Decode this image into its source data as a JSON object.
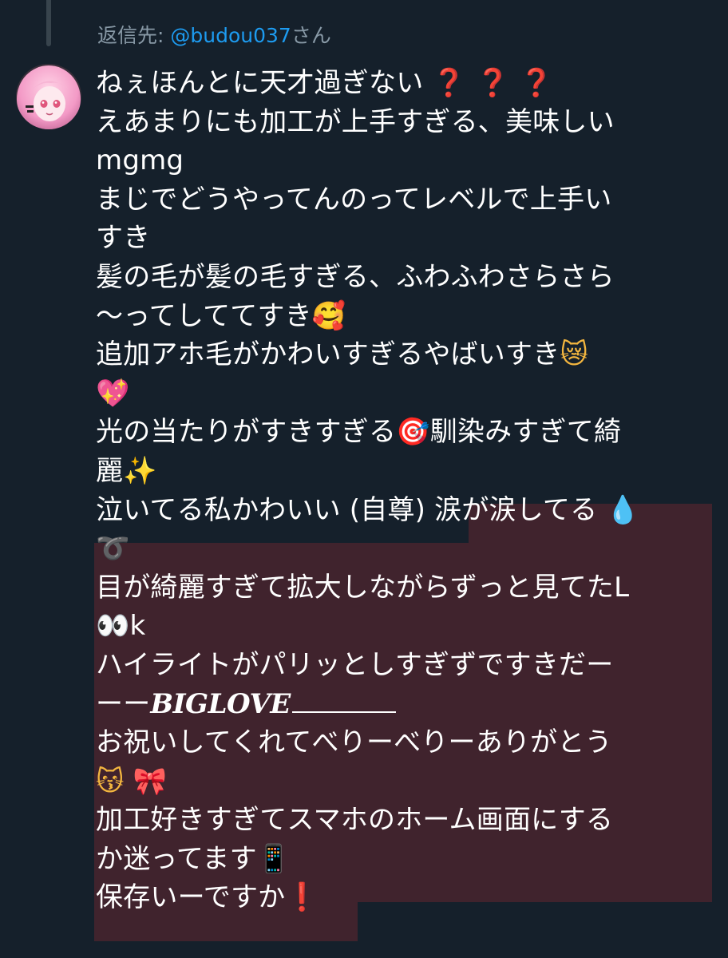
{
  "reply": {
    "prefix": "返信先:",
    "handle": "@budou037",
    "suffix": "さん"
  },
  "tweet": {
    "line1_text": "ねぇほんとに天才過ぎない",
    "line1_marks": "❓ ❓ ❓",
    "line2": "えあまりにも加工が上手すぎる、美味しい",
    "line3": " mgmg",
    "line4": "まじでどうやってんのってレベルで上手い",
    "line5": "すき",
    "line6": "髪の毛が髪の毛すぎる、ふわふわさらさら",
    "line7_text": "～ってしててすき",
    "line7_emoji": "🥰",
    "line8_text": "追加アホ毛がかわいすぎるやばいすき",
    "line8_emoji": "😿",
    "line9_emoji": "💖",
    "line10_text_a": "光の当たりがすきすぎる",
    "line10_emoji": "🎯",
    "line10_text_b": "馴染みすぎて綺",
    "line11_text": "麗",
    "line11_emoji": "✨",
    "line12_text_a": "泣いてる私かわいい (自尊) ",
    "line12_text_b": "涙が涙してる",
    "line12_emoji": "💧",
    "line13_emoji": "➰",
    "line14": "目が綺麗すぎて拡大しながらずっと見てたL",
    "line15_emoji": "👀",
    "line15_text": "k",
    "line16": "ハイライトがパリッとしすぎずですきだー",
    "line17_text_a": "ーー",
    "line17_text_b": "BIGLOVE",
    "line18": "お祝いしてくれてべりーべりーありがとう",
    "line19_emoji_a": "😽",
    "line19_emoji_b": "🎀",
    "line20": "加工好きすぎてスマホのホーム画面にする",
    "line21_text": "か迷ってます",
    "line21_emoji": "📱",
    "line22_text": "保存いーですか",
    "line22_emoji": "❗"
  },
  "colors": {
    "background": "#15202b",
    "highlight": "#40232d",
    "link": "#1d9bf0",
    "muted": "#8899a6"
  }
}
